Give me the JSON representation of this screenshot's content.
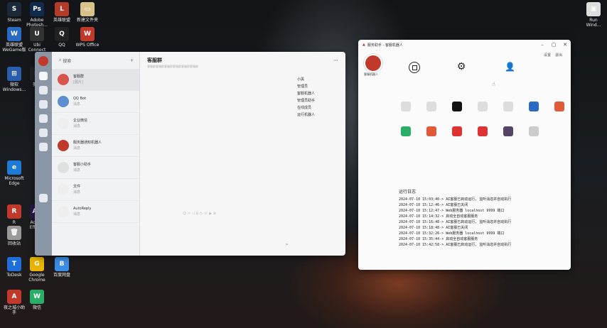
{
  "desktop": {
    "icons": [
      {
        "label": "Steam",
        "color": "#1b2838",
        "glyph": "S"
      },
      {
        "label": "Adobe Photosh...",
        "color": "#0f2a4a",
        "glyph": "Ps"
      },
      {
        "label": "英雄联盟",
        "color": "#b53a2a",
        "glyph": "L"
      },
      {
        "label": "新建文件夹",
        "color": "#d8c28a",
        "glyph": "▭"
      },
      {
        "label": "英雄联盟 WeGame版",
        "color": "#2a6ac0",
        "glyph": "W"
      },
      {
        "label": "Ubi Connect",
        "color": "#333",
        "glyph": "U"
      },
      {
        "label": "QQ",
        "color": "#222",
        "glyph": "Q"
      },
      {
        "label": "WPS Office",
        "color": "#c0392b",
        "glyph": "W"
      },
      {
        "label": "微软 Windows...",
        "color": "#2b5dad",
        "glyph": "⊞"
      },
      {
        "label": "剪映",
        "color": "#222",
        "glyph": "✂"
      },
      {
        "label": "Microsoft Edge",
        "color": "#1d7bd6",
        "glyph": "e"
      },
      {
        "label": "R",
        "color": "#c0392b",
        "glyph": "R"
      },
      {
        "label": "Adobe Effects",
        "color": "#2a1a4a",
        "glyph": "Ae"
      },
      {
        "label": "回收站",
        "color": "#999",
        "glyph": "🗑"
      },
      {
        "label": "ToDesk",
        "color": "#1e6fd9",
        "glyph": "T"
      },
      {
        "label": "Google Chrome",
        "color": "#e8b400",
        "glyph": "G"
      },
      {
        "label": "百度网盘",
        "color": "#3a8ee6",
        "glyph": "B"
      },
      {
        "label": "夜之城小助手",
        "color": "#c0392b",
        "glyph": "A"
      },
      {
        "label": "微信",
        "color": "#2aae67",
        "glyph": "W"
      },
      {
        "label": "Run Wind...",
        "color": "#ddd",
        "glyph": "▣"
      }
    ]
  },
  "chat": {
    "search_placeholder": "搜索",
    "title": "客服群",
    "title_sub": "客服群客服群客服群客服群客服群客服群",
    "conversations": [
      {
        "name": "客服群",
        "preview": "[图片]",
        "color": "#d9534f"
      },
      {
        "name": "QQ Bot",
        "preview": "消息",
        "color": "#5b8fd1"
      },
      {
        "name": "企业微信",
        "preview": "消息",
        "color": "#eee"
      },
      {
        "name": "服务器通知机器人",
        "preview": "消息",
        "color": "#c0392b"
      },
      {
        "name": "客服小助手",
        "preview": "消息",
        "color": "#e0e0e0"
      },
      {
        "name": "文件",
        "preview": "消息",
        "color": "#eee"
      },
      {
        "name": "AutoReply",
        "preview": "消息",
        "color": "#eee"
      }
    ],
    "members": [
      "小黑",
      "管理员",
      "客服机器人",
      "管理员助手",
      "在线成员",
      "运行机器人"
    ]
  },
  "tool": {
    "title": "服务助手 - 客服机器人",
    "user_name": "客服机器人",
    "ctrl": [
      "设置",
      "退出"
    ],
    "log_title": "运行日志",
    "log": [
      "2024-07-10 15:03:40-> AI客服已启动运行, 监听消息并自动执行",
      "2024-07-10 15:12:46-> AI客服已关闭",
      "2024-07-10 15:12:47-> Web服务器 localhost 9999 端口",
      "2024-07-10 15:14:32-> 启动全自动客服服务",
      "2024-07-10 15:16:48-> AI客服已启动运行, 监听消息并自动执行",
      "2024-07-10 15:18:48-> AI客服已关闭",
      "2024-07-10 15:32:26-> Web服务器 localhost 9999 端口",
      "2024-07-10 15:35:44-> 启动全自动客服服务",
      "2024-07-10 15:42:58-> AI客服已启动运行, 监听消息并自动执行"
    ]
  }
}
